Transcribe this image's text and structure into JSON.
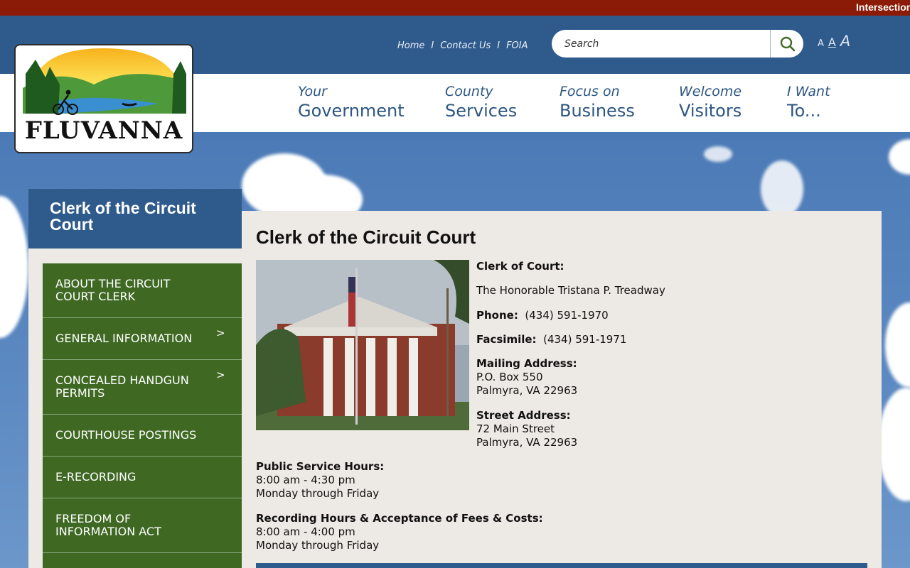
{
  "ticker": "Intersection",
  "utility_nav": {
    "home": "Home",
    "contact": "Contact Us",
    "foia": "FOIA",
    "sep": "I"
  },
  "search": {
    "placeholder": "Search"
  },
  "font_size": {
    "small": "A",
    "medium": "A",
    "large": "A"
  },
  "logo": {
    "text": "FLUVANNA"
  },
  "main_nav": [
    {
      "line1": "Your",
      "line2": "Government"
    },
    {
      "line1": "County",
      "line2": "Services"
    },
    {
      "line1": "Focus on",
      "line2": "Business"
    },
    {
      "line1": "Welcome",
      "line2": "Visitors"
    },
    {
      "line1": "I Want",
      "line2": "To..."
    }
  ],
  "sidebar": {
    "title": "Clerk of the Circuit Court",
    "items": [
      {
        "label": "About the Circuit Court Clerk",
        "chevron": ""
      },
      {
        "label": "General Information",
        "chevron": ">"
      },
      {
        "label": "Concealed Handgun Permits",
        "chevron": ">"
      },
      {
        "label": "Courthouse Postings",
        "chevron": ""
      },
      {
        "label": "E-Recording",
        "chevron": ""
      },
      {
        "label": "Freedom of Information Act",
        "chevron": ""
      }
    ]
  },
  "content": {
    "title": "Clerk of the Circuit Court",
    "clerk_label": "Clerk of Court:",
    "clerk_name": "The Honorable Tristana P. Treadway",
    "phone_label": "Phone:",
    "phone": "(434) 591-1970",
    "fax_label": "Facsimile:",
    "fax": "(434) 591-1971",
    "mailing_label": "Mailing Address:",
    "mailing_line1": "P.O. Box 550",
    "mailing_line2": "Palmyra, VA  22963",
    "street_label": "Street Address:",
    "street_line1": "72 Main Street",
    "street_line2": "Palmyra, VA  22963",
    "hours_label": "Public Service Hours:",
    "hours_time": "8:00 am - 4:30 pm",
    "hours_days": "Monday through Friday",
    "rec_label": "Recording Hours & Acceptance of Fees & Costs:",
    "rec_time": "8:00 am - 4:00 pm",
    "rec_days": "Monday through Friday"
  },
  "colors": {
    "header_blue": "#2f5a8c",
    "top_bar": "#8b1a06",
    "sidebar_green": "#3f6923",
    "content_bg": "#ede9e4",
    "nav_text": "#2d5783"
  }
}
